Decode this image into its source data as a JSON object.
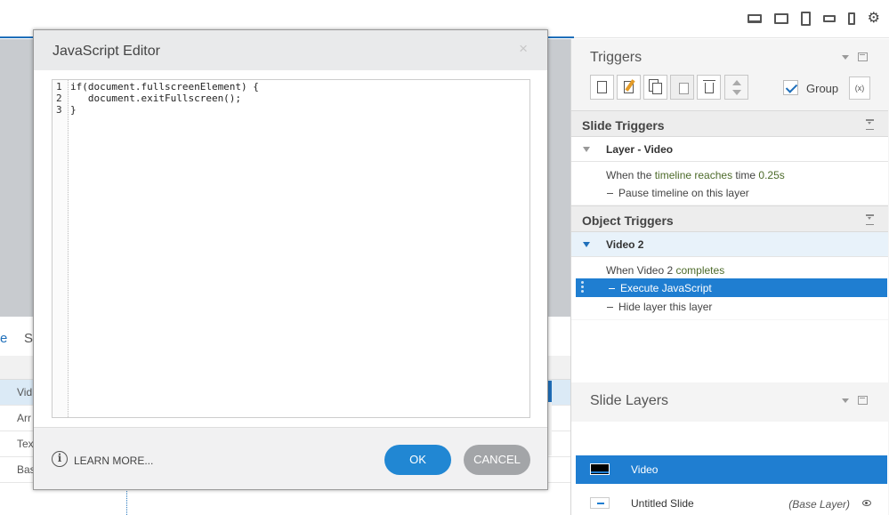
{
  "dialog": {
    "title": "JavaScript Editor",
    "close_glyph": "×",
    "code_lines": [
      {
        "n": "1",
        "text": "if(document.fullscreenElement) {"
      },
      {
        "n": "2",
        "text": "   document.exitFullscreen();"
      },
      {
        "n": "3",
        "text": "}"
      }
    ],
    "learn_more": "LEARN MORE...",
    "info_glyph": "i",
    "ok_label": "OK",
    "cancel_label": "CANCEL"
  },
  "timeline": {
    "tabs": [
      "e",
      "S"
    ],
    "rows": [
      "Vid",
      "Arr",
      "Tex",
      "Bas"
    ]
  },
  "triggers_panel": {
    "title": "Triggers",
    "group_label": "Group",
    "group_checked": true,
    "var_glyph": "(x)",
    "slide_triggers_label": "Slide Triggers",
    "slide_layer_head": "Layer - Video",
    "slide_when": {
      "a": "When the ",
      "b": "timeline reaches",
      "c": " time ",
      "d": "0.25s"
    },
    "slide_action": {
      "a": "Pause timeline on ",
      "b": "this layer"
    },
    "object_triggers_label": "Object Triggers",
    "object_head": "Video 2",
    "object_when": {
      "a": "When Video 2 ",
      "b": "completes"
    },
    "object_action_1": "Execute JavaScript",
    "object_action_2": {
      "a": "Hide layer ",
      "b": "this layer"
    }
  },
  "layers_panel": {
    "title": "Slide Layers",
    "layers": [
      {
        "name": "Video",
        "selected": true
      },
      {
        "name": "Untitled Slide",
        "base": "(Base Layer)"
      }
    ]
  },
  "colors": {
    "accent": "#1f7ed1",
    "ok": "#2187d3",
    "cancel": "#a3a5a8"
  }
}
